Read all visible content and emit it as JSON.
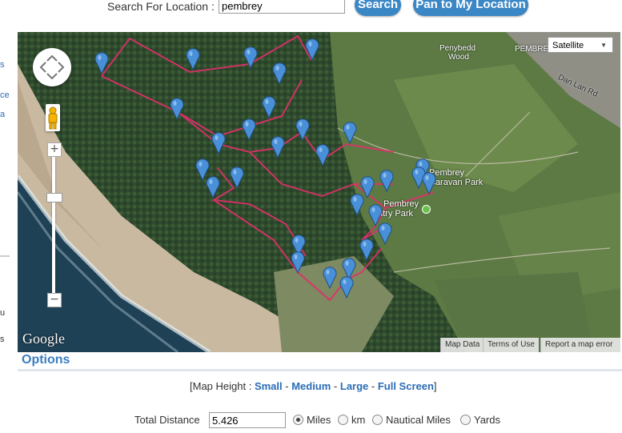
{
  "search": {
    "label": "Search For Location :",
    "value": "pembrey",
    "search_button": "Search",
    "pan_button": "Pan to My Location"
  },
  "map": {
    "map_type": "Satellite",
    "labels": {
      "penybedd": "Penybedd",
      "wood": "Wood",
      "pembre": "PEMBRE",
      "dan_lan": "Dan Lan Rd",
      "caravan1": "Pembrey",
      "caravan2": "Caravan Park",
      "country1": "Pembrey",
      "country2": "ntry Park"
    },
    "google": "Google",
    "footer": {
      "map_data": "Map Data",
      "terms": "Terms of Use",
      "report": "Report a map error"
    },
    "zoom_in": "+",
    "zoom_out": "−"
  },
  "side": {
    "s": "s",
    "ce": "ce",
    "a": "a",
    "u": "u",
    "s2": "s"
  },
  "options": {
    "title": "Options",
    "map_height_prefix": "[Map Height : ",
    "small": "Small",
    "sep1": " - ",
    "medium": "Medium",
    "sep2": " - ",
    "large": "Large",
    "sep3": " - ",
    "full": "Full Screen",
    "map_height_suffix": "]",
    "total_label": "Total Distance",
    "total_value": "5.426",
    "units": [
      "Miles",
      "km",
      "Nautical Miles",
      "Yards"
    ],
    "selected_unit": "Miles"
  },
  "colors": {
    "accent": "#3a87c6",
    "route": "#e0306a",
    "pin": "#4a90d9"
  }
}
